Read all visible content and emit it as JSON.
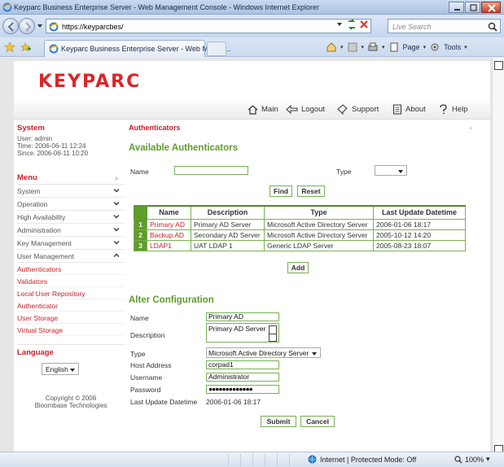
{
  "browser": {
    "window_title": "Keyparc Business Enterprise Server - Web Management Console - Windows Internet Explorer",
    "url": "https://keyparcbes/",
    "search_placeholder": "Live Search",
    "tab_label": "Keyparc Business Enterprise Server - Web Manag...",
    "cmd_page": "Page",
    "cmd_tools": "Tools",
    "status_zone": "Internet | Protected Mode: Off",
    "zoom": "100%"
  },
  "app": {
    "logo": "KEYPARC",
    "nav": {
      "main": "Main",
      "logout": "Logout",
      "support": "Support",
      "about": "About",
      "help": "Help"
    }
  },
  "sidebar": {
    "system_title": "System",
    "user": "User: admin",
    "time": "Time: 2006-06-11 12:24",
    "since": "Since: 2006-06-11 10:20",
    "menu_title": "Menu",
    "menu_items": [
      {
        "label": "System"
      },
      {
        "label": "Operation"
      },
      {
        "label": "High Availability"
      },
      {
        "label": "Administration"
      },
      {
        "label": "Key Management"
      },
      {
        "label": "User Management"
      }
    ],
    "sub_items": [
      {
        "label": "Authenticators"
      },
      {
        "label": "Validators"
      },
      {
        "label": "Local User Repository"
      },
      {
        "label": "Authenticator"
      },
      {
        "label": "User Storage"
      },
      {
        "label": "Virtual Storage"
      }
    ],
    "language_title": "Language",
    "language_value": "English",
    "copyright_line1": "Copyright © 2006",
    "copyright_line2": "Bloombase Technologies"
  },
  "content": {
    "breadcrumb": "Authenticators",
    "available_title": "Available Authenticators",
    "filter": {
      "name_label": "Name",
      "name_value": "",
      "type_label": "Type",
      "type_value": "",
      "find_button": "Find",
      "reset_button": "Reset"
    },
    "table": {
      "headers": [
        "Name",
        "Description",
        "Type",
        "Last Update Datetime"
      ],
      "rows": [
        {
          "idx": "1",
          "name": "Primary AD",
          "description": "Primary AD Server",
          "type": "Microsoft Active Directory Server",
          "updated": "2006-01-06 18:17"
        },
        {
          "idx": "2",
          "name": "Backup AD",
          "description": "Secondary AD Server",
          "type": "Microsoft Active Directory Server",
          "updated": "2005-10-12 14:20"
        },
        {
          "idx": "3",
          "name": "LDAP1",
          "description": "UAT LDAP 1",
          "type": "Generic LDAP Server",
          "updated": "2005-08-23 18:07"
        }
      ],
      "add_button": "Add"
    },
    "alter": {
      "title": "Alter Configuration",
      "name_label": "Name",
      "name_value": "Primary AD",
      "description_label": "Description",
      "description_value": "Primary AD Server",
      "type_label": "Type",
      "type_value": "Microsoft Active Directory Server",
      "host_label": "Host Address",
      "host_value": "corpad1",
      "username_label": "Username",
      "username_value": "Administrator",
      "password_label": "Password",
      "password_value": "●●●●●●●●●●●●●",
      "updated_label": "Last Update Datetime",
      "updated_value": "2006-01-06 18:17",
      "submit_button": "Submit",
      "cancel_button": "Cancel"
    }
  },
  "colors": {
    "brand_red": "#c8202a",
    "accent_green": "#5e9c2c"
  }
}
